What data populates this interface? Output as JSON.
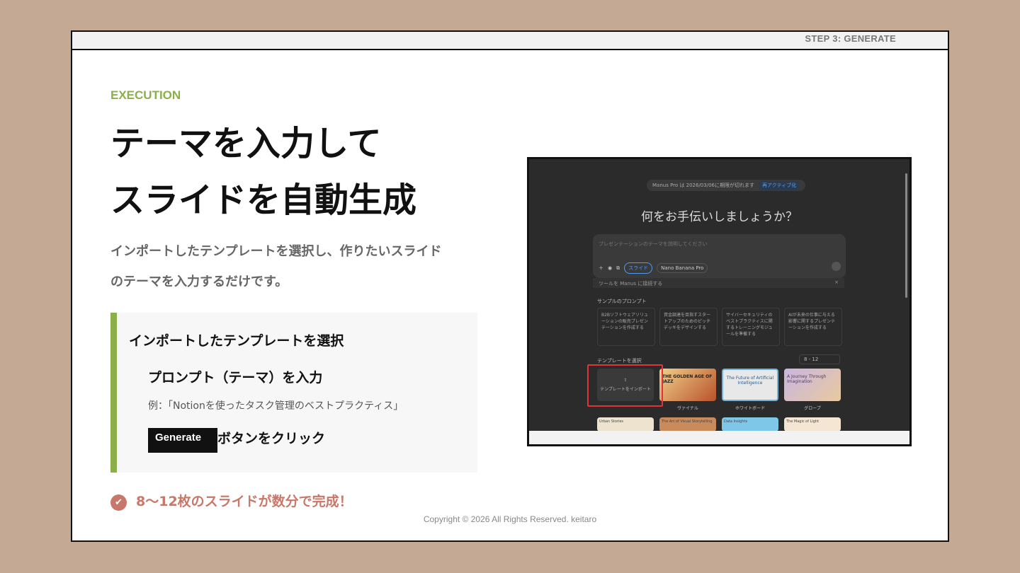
{
  "header": {
    "step": "STEP 3: GENERATE"
  },
  "eyebrow": "EXECUTION",
  "title": {
    "line1": "テーマを入力して",
    "line2": "スライドを自動生成"
  },
  "lead": {
    "line1": "インポートしたテンプレートを選択し、作りたいスライド",
    "line2": "のテーマを入力するだけです。"
  },
  "steps": {
    "step1": "インポートしたテンプレートを選択",
    "step2": "プロンプト（テーマ）を入力",
    "step2_example": "例：「Notionを使ったタスク管理のベストプラクティス」",
    "step3_button": "Generate",
    "step3_text": "ボタンをクリック"
  },
  "result": "8〜12枚のスライドが数分で完成！",
  "copyright": "Copyright © 2026 All Rights Reserved. keitaro",
  "screenshot": {
    "banner_text": "Manus Pro は 2026/03/06に期限が切れます",
    "banner_action": "再アクティブ化",
    "question": "何をお手伝いしましょうか？",
    "input_placeholder": "プレゼンテーションのテーマを説明してください",
    "chip_slide": "スライド",
    "chip_model": "Nano Banana Pro",
    "connect_text": "ツールを Manus に接続する",
    "connect_close": "×",
    "prompts_heading": "サンプルのプロンプト",
    "prompts": [
      "B2Bソフトウェアソリューションの販売プレゼンテーションを作成する",
      "資金調達を目指すスタートアップのためのピッチデッキをデザインする",
      "サイバーセキュリティのベストプラクティスに関するトレーニングモジュールを準備する",
      "AIが未来の仕事に与える影響に関するプレゼンテーションを作成する"
    ],
    "templates_heading": "テンプレートを選択",
    "size_select": "8 - 12",
    "import_label": "テンプレートをインポート",
    "templates": [
      {
        "label": "ヴァイナル",
        "title": "THE GOLDEN AGE OF JAZZ"
      },
      {
        "label": "ホワイトボード",
        "title": "The Future of Artificial Intelligence"
      },
      {
        "label": "グロープ",
        "title": "A Journey Through Imagination"
      }
    ],
    "row2": [
      "Urban Stories",
      "The Art of Visual Storytelling",
      "Data Insights",
      "The Magic of Light"
    ],
    "colors": {
      "highlight": "#e0333a",
      "accent_blue": "#4d9cf0"
    }
  },
  "colors": {
    "accent_green": "#8bb04a",
    "accent_red": "#c8786a",
    "background": "#c4a994"
  }
}
